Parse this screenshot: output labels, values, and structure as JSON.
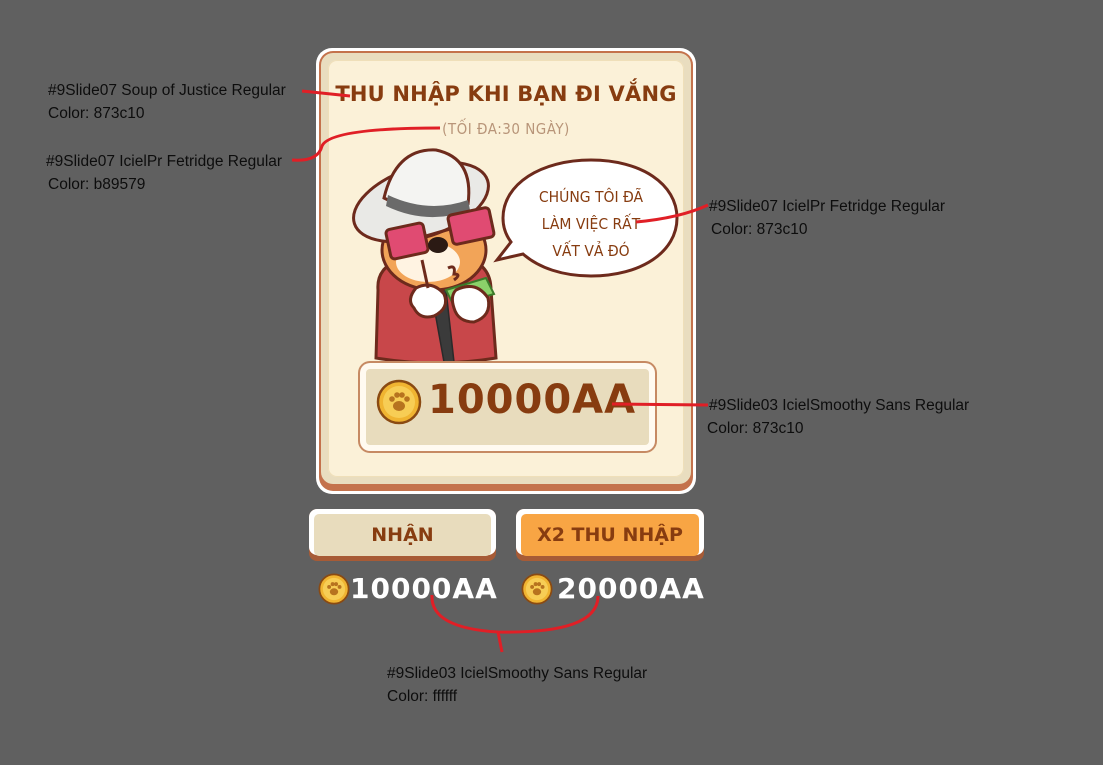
{
  "popup": {
    "title": "THU NHẬP KHI BẠN ĐI VẮNG",
    "subtitle": "(TỐI ĐA:30 NGÀY)",
    "speech_lines": [
      "CHÚNG TÔI ĐÃ",
      "LÀM VIỆC RẤT",
      "VẤT VẢ ĐÓ"
    ],
    "reward_amount": "10000AA"
  },
  "buttons": {
    "claim_label": "NHẬN",
    "double_label": "X2 THU NHẬP"
  },
  "amounts": {
    "claim": "10000AA",
    "double": "20000AA"
  },
  "annotations": [
    {
      "font": "#9Slide07 Soup of Justice Regular",
      "color": "Color: 873c10"
    },
    {
      "font": "#9Slide07 IcielPr Fetridge Regular",
      "color": "Color: b89579"
    },
    {
      "font": "#9Slide07 IcielPr Fetridge Regular",
      "color": "Color: 873c10"
    },
    {
      "font": "#9Slide03 IcielSmoothy Sans Regular",
      "color": "Color: 873c10"
    },
    {
      "font": "#9Slide03 IcielSmoothy Sans Regular",
      "color": "Color: ffffff"
    }
  ],
  "colors": {
    "background": "#606060",
    "title_brown": "#873c10",
    "subtitle_tan": "#b89579",
    "card_cream": "#fbf1d8",
    "button_orange": "#f8a544",
    "annotation_line_red": "#e01f26"
  },
  "icons": {
    "coin": "paw-coin-icon",
    "mascot": "corgi-mascot-illustration"
  }
}
